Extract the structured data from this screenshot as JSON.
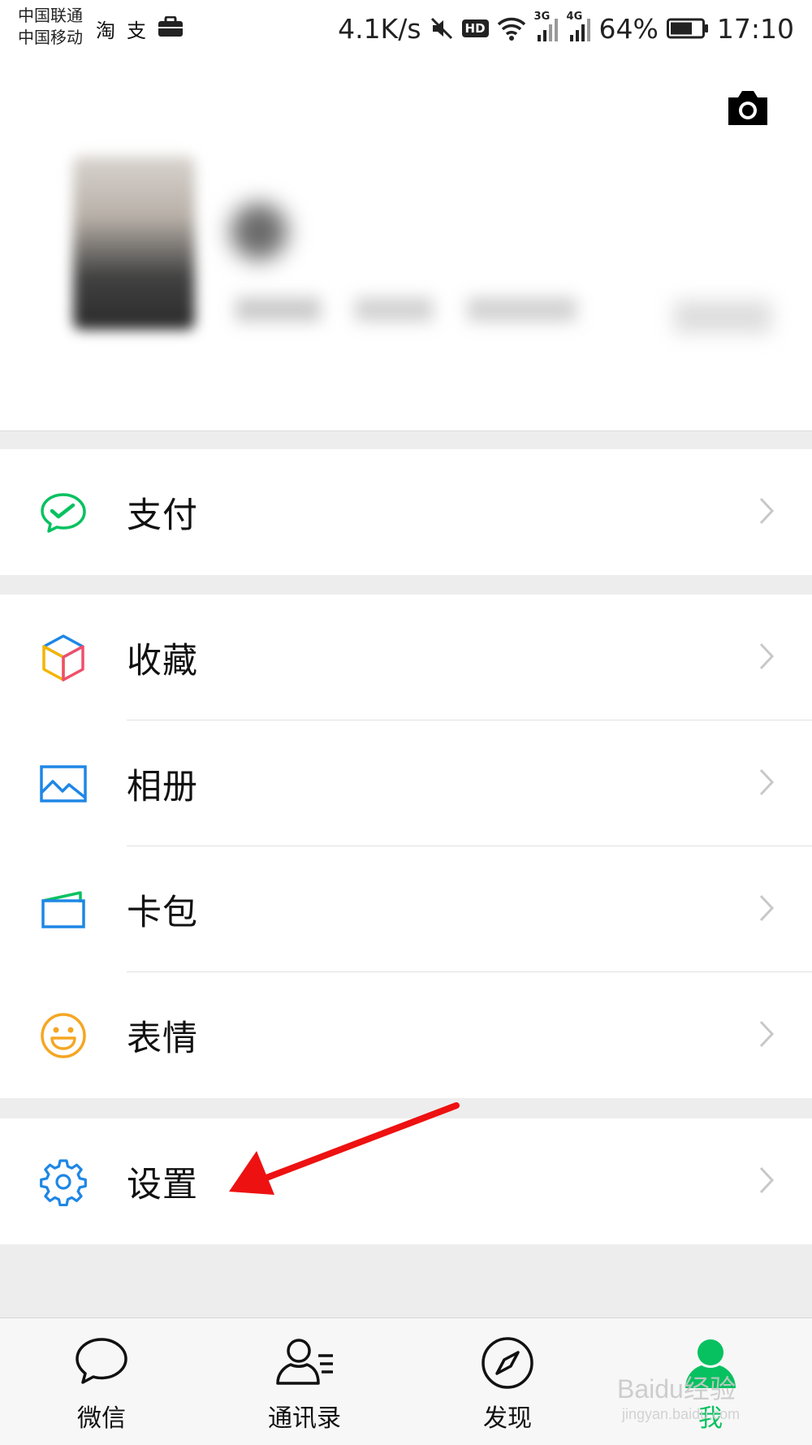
{
  "status_bar": {
    "carrier_1": "中国联通",
    "carrier_2": "中国移动",
    "net_speed": "4.1K/s",
    "hd": "HD",
    "net_3g": "3G",
    "net_4g": "4G",
    "battery": "64%",
    "time": "17:10",
    "notif_icon_1": "淘",
    "notif_icon_2": "支"
  },
  "profile": {
    "camera_icon": "camera-icon"
  },
  "menu": {
    "pay": "支付",
    "favorites": "收藏",
    "album": "相册",
    "cards": "卡包",
    "stickers": "表情",
    "settings": "设置"
  },
  "tabs": [
    {
      "label": "微信",
      "icon": "chat-bubble-icon"
    },
    {
      "label": "通讯录",
      "icon": "contacts-icon"
    },
    {
      "label": "发现",
      "icon": "compass-icon"
    },
    {
      "label": "我",
      "icon": "me-person-icon",
      "active": true
    }
  ],
  "colors": {
    "accent_green": "#07c160",
    "annotation_red": "#ee1111",
    "settings_blue": "#1e87e5"
  },
  "watermark": {
    "brand": "Baidu经验",
    "url": "jingyan.baidu.com"
  }
}
